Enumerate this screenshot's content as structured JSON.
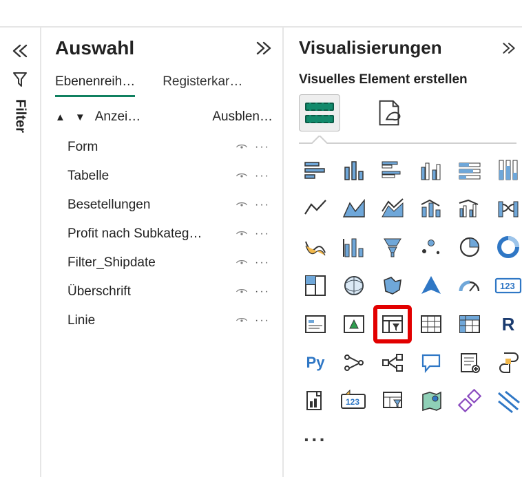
{
  "filter_rail": {
    "label": "Filter"
  },
  "selection": {
    "title": "Auswahl",
    "tabs": {
      "layers": "Ebenenreih…",
      "bookmarks": "Registerkar…"
    },
    "sort": {
      "show": "Anzei…",
      "hide": "Ausblen…"
    },
    "items": [
      {
        "label": "Form"
      },
      {
        "label": "Tabelle"
      },
      {
        "label": "Besetellungen"
      },
      {
        "label": "Profit nach Subkateg…"
      },
      {
        "label": "Filter_Shipdate"
      },
      {
        "label": "Überschrift"
      },
      {
        "label": "Linie"
      }
    ]
  },
  "viz": {
    "title": "Visualisierungen",
    "subtitle": "Visuelles Element erstellen",
    "more": "···"
  }
}
